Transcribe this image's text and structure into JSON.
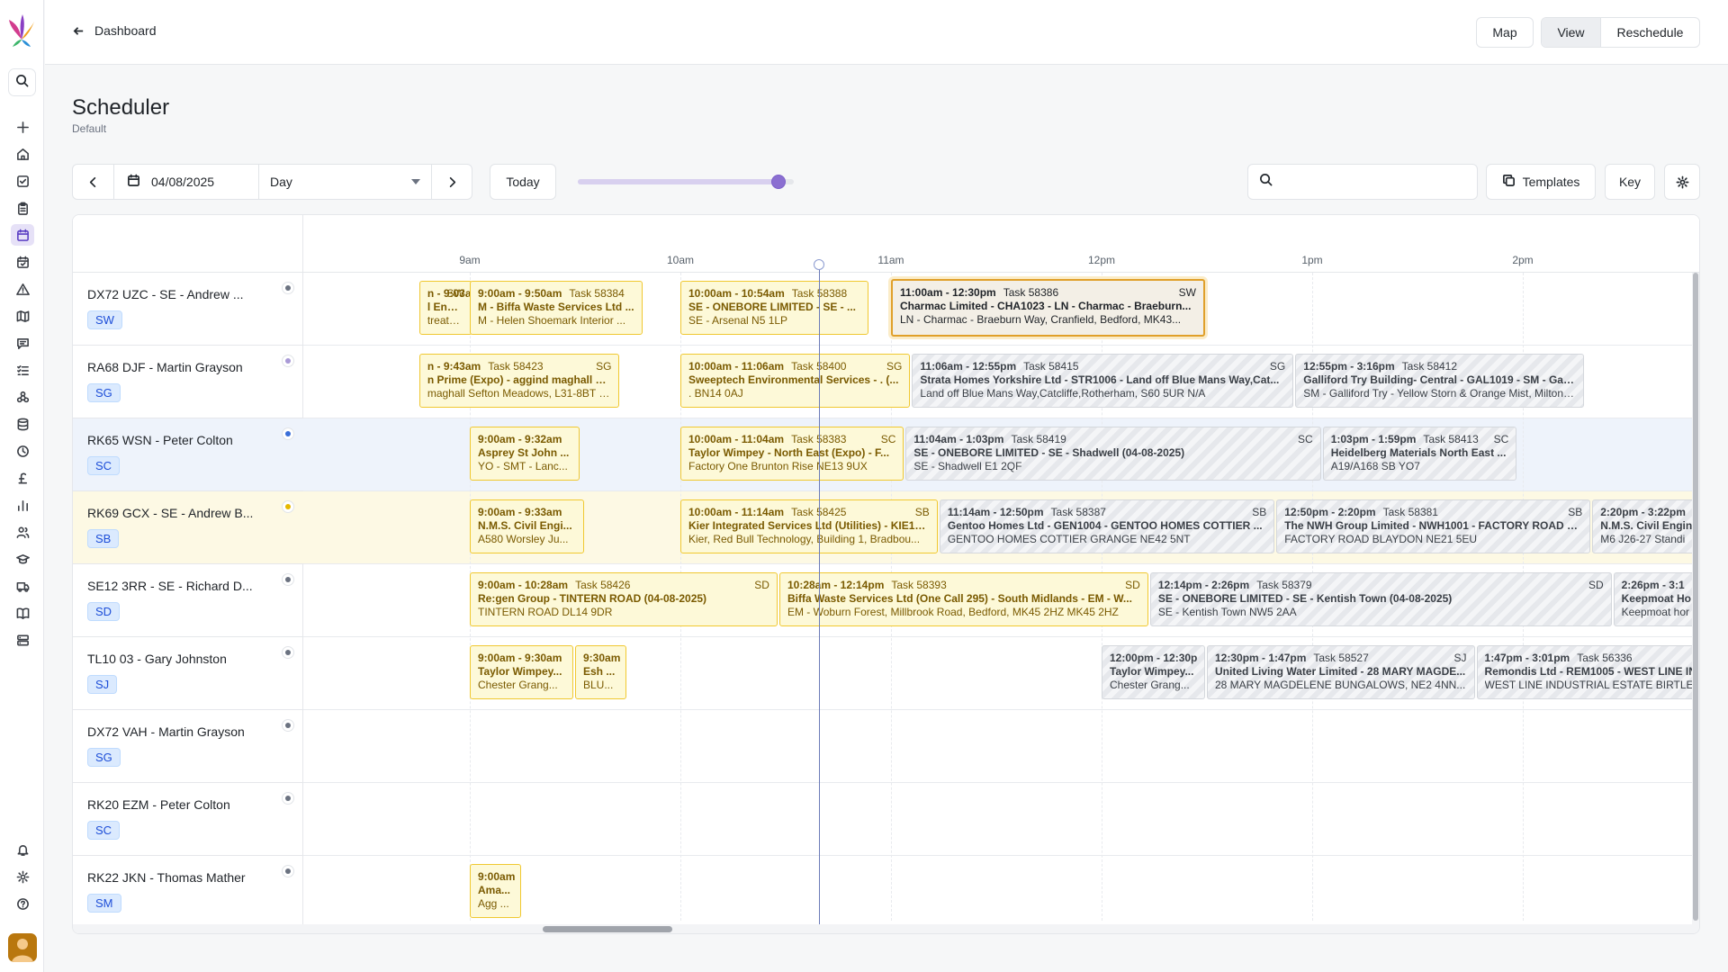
{
  "nav": {
    "back_label": "Dashboard"
  },
  "header_buttons": {
    "map": "Map",
    "view": "View",
    "reschedule": "Reschedule"
  },
  "page": {
    "title": "Scheduler",
    "subtitle": "Default"
  },
  "toolbar": {
    "date": "04/08/2025",
    "view_mode": "Day",
    "today_label": "Today",
    "zoom_level": 0.93,
    "search_placeholder": "",
    "templates_label": "Templates",
    "key_label": "Key"
  },
  "timeline": {
    "hours": [
      "9am",
      "10am",
      "11am",
      "12pm",
      "1pm",
      "2pm"
    ]
  },
  "resources": [
    {
      "name": "DX72 UZC - SE - Andrew ...",
      "badge": "SW",
      "status_color": "#6b7280"
    },
    {
      "name": "RA68 DJF - Martin Grayson",
      "badge": "SG",
      "status_color": "#a99ad6"
    },
    {
      "name": "RK65 WSN - Peter Colton",
      "badge": "SC",
      "status_color": "#3b6fd8"
    },
    {
      "name": "RK69 GCX - SE - Andrew B...",
      "badge": "SB",
      "status_color": "#e6b800"
    },
    {
      "name": "SE12 3RR - SE - Richard D...",
      "badge": "SD",
      "status_color": "#6b7280"
    },
    {
      "name": "TL10 03 - Gary Johnston",
      "badge": "SJ",
      "status_color": "#6b7280"
    },
    {
      "name": "DX72 VAH - Martin Grayson",
      "badge": "SG",
      "status_color": "#6b7280"
    },
    {
      "name": "RK20 EZM - Peter Colton",
      "badge": "SC",
      "status_color": "#6b7280"
    },
    {
      "name": "RK22 JKN - Thomas Mather",
      "badge": "SM",
      "status_color": "#6b7280"
    }
  ],
  "tasks": [
    {
      "row": 0,
      "start": 8.76,
      "end": 9.02,
      "style": "y",
      "time": "n - 9:03am",
      "task": "Task 58385",
      "initials": "SW",
      "title": "l Engineering & Utilities Ltd - S...",
      "addr": "treatment works, Wheatley Hal..."
    },
    {
      "row": 0,
      "start": 9.0,
      "end": 9.83,
      "style": "y",
      "time": "9:00am - 9:50am",
      "task": "Task 58384",
      "initials": "",
      "title": "M - Biffa Waste Services Ltd ...",
      "addr": "M - Helen Shoemark Interior ..."
    },
    {
      "row": 0,
      "start": 10.0,
      "end": 10.9,
      "style": "y",
      "time": "10:00am - 10:54am",
      "task": "Task 58388",
      "initials": "",
      "title": "SE - ONEBORE LIMITED - SE - ...",
      "addr": "SE - Arsenal N5 1LP"
    },
    {
      "row": 0,
      "start": 11.0,
      "end": 12.5,
      "style": "sel",
      "time": "11:00am - 12:30pm",
      "task": "Task 58386",
      "initials": "SW",
      "title": "Charmac Limited - CHA1023 - LN - Charmac - Braeburn...",
      "addr": "LN - Charmac - Braeburn Way, Cranfield, Bedford, MK43..."
    },
    {
      "row": 1,
      "start": 8.76,
      "end": 9.72,
      "style": "y",
      "time": "n - 9:43am",
      "task": "Task 58423",
      "initials": "SG",
      "title": "n Prime (Expo) - aggind maghall Sefton Meadows, L31-8B...",
      "addr": "maghall Sefton Meadows, L31-8BT L31-8BT"
    },
    {
      "row": 1,
      "start": 10.0,
      "end": 11.1,
      "style": "y",
      "time": "10:00am - 11:06am",
      "task": "Task 58400",
      "initials": "SG",
      "title": "Sweeptech Environmental Services - . (...",
      "addr": ". BN14 0AJ"
    },
    {
      "row": 1,
      "start": 11.1,
      "end": 12.92,
      "style": "g",
      "time": "11:06am - 12:55pm",
      "task": "Task 58415",
      "initials": "SG",
      "title": "Strata Homes Yorkshire Ltd - STR1006 - Land off Blue Mans Way,Cat...",
      "addr": "Land off Blue Mans Way,Catcliffe,Rotherham, S60 5UR N/A"
    },
    {
      "row": 1,
      "start": 12.92,
      "end": 14.3,
      "style": "g",
      "time": "12:55pm - 3:16pm",
      "task": "Task 58412",
      "initials": "",
      "title": "Galliford Try Building- Central - GAL1019 - SM - Galliford Try - Yellow Storn &",
      "addr": "SM - Galliford Try - Yellow Storn & Orange Mist, Milton Keynes, MK19 7BH MK"
    },
    {
      "row": 2,
      "start": 9.0,
      "end": 9.53,
      "style": "y",
      "time": "9:00am - 9:32am",
      "task": "",
      "initials": "",
      "title": "Asprey St John ...",
      "addr": "YO - SMT - Lanc..."
    },
    {
      "row": 2,
      "start": 10.0,
      "end": 11.07,
      "style": "y",
      "time": "10:00am - 11:04am",
      "task": "Task 58383",
      "initials": "SC",
      "title": "Taylor Wimpey - North East (Expo) - F...",
      "addr": "Factory One Brunton Rise NE13 9UX"
    },
    {
      "row": 2,
      "start": 11.07,
      "end": 13.05,
      "style": "g",
      "time": "11:04am - 1:03pm",
      "task": "Task 58419",
      "initials": "SC",
      "title": "SE - ONEBORE LIMITED - SE - Shadwell (04-08-2025)",
      "addr": "SE - Shadwell E1 2QF"
    },
    {
      "row": 2,
      "start": 13.05,
      "end": 13.98,
      "style": "g",
      "time": "1:03pm - 1:59pm",
      "task": "Task 58413",
      "initials": "SC",
      "title": "Heidelberg Materials North East ...",
      "addr": "A19/A168 SB YO7"
    },
    {
      "row": 3,
      "start": 9.0,
      "end": 9.55,
      "style": "y",
      "time": "9:00am - 9:33am",
      "task": "",
      "initials": "",
      "title": "N.M.S. Civil Engi...",
      "addr": "A580 Worsley Ju..."
    },
    {
      "row": 3,
      "start": 10.0,
      "end": 11.23,
      "style": "y",
      "time": "10:00am - 11:14am",
      "task": "Task 58425",
      "initials": "SB",
      "title": "Kier Integrated Services Ltd (Utilities) - KIE10...",
      "addr": "Kier, Red Bull Technology, Building 1, Bradbou..."
    },
    {
      "row": 3,
      "start": 11.23,
      "end": 12.83,
      "style": "g",
      "time": "11:14am - 12:50pm",
      "task": "Task 58387",
      "initials": "SB",
      "title": "Gentoo Homes Ltd - GEN1004 - GENTOO HOMES COTTIER ...",
      "addr": "GENTOO HOMES COTTIER GRANGE NE42 5NT"
    },
    {
      "row": 3,
      "start": 12.83,
      "end": 14.33,
      "style": "g",
      "time": "12:50pm - 2:20pm",
      "task": "Task 58381",
      "initials": "SB",
      "title": "The NWH Group Limited - NWH1001 - FACTORY ROAD B...",
      "addr": "FACTORY ROAD BLAYDON NE21 5EU"
    },
    {
      "row": 3,
      "start": 14.33,
      "end": 14.9,
      "style": "g",
      "time": "2:20pm - 3:22pm",
      "task": "",
      "initials": "",
      "title": "N.M.S. Civil Engin",
      "addr": "M6 J26-27 Standi"
    },
    {
      "row": 4,
      "start": 9.0,
      "end": 10.47,
      "style": "y",
      "time": "9:00am - 10:28am",
      "task": "Task 58426",
      "initials": "SD",
      "title": "Re:gen Group - TINTERN ROAD (04-08-2025)",
      "addr": "TINTERN ROAD DL14 9DR"
    },
    {
      "row": 4,
      "start": 10.47,
      "end": 12.23,
      "style": "y",
      "time": "10:28am - 12:14pm",
      "task": "Task 58393",
      "initials": "SD",
      "title": "Biffa Waste Services Ltd (One Call 295) - South Midlands - EM - W...",
      "addr": "EM - Woburn Forest, Millbrook Road, Bedford, MK45 2HZ MK45 2HZ"
    },
    {
      "row": 4,
      "start": 12.23,
      "end": 14.43,
      "style": "g",
      "time": "12:14pm - 2:26pm",
      "task": "Task 58379",
      "initials": "SD",
      "title": "SE - ONEBORE LIMITED - SE - Kentish Town (04-08-2025)",
      "addr": "SE - Kentish Town NW5 2AA"
    },
    {
      "row": 4,
      "start": 14.43,
      "end": 14.9,
      "style": "g",
      "time": "2:26pm - 3:1",
      "task": "",
      "initials": "",
      "title": "Keepmoat Ho",
      "addr": "Keepmoat hor"
    },
    {
      "row": 5,
      "start": 9.0,
      "end": 9.5,
      "style": "y",
      "time": "9:00am - 9:30am",
      "task": "",
      "initials": "",
      "title": "Taylor Wimpey...",
      "addr": "Chester Grang..."
    },
    {
      "row": 5,
      "start": 9.5,
      "end": 9.75,
      "style": "y",
      "time": "9:30am",
      "task": "",
      "initials": "",
      "title": "Esh ...",
      "addr": "BLU..."
    },
    {
      "row": 5,
      "start": 12.0,
      "end": 12.5,
      "style": "g",
      "time": "12:00pm - 12:30p",
      "task": "",
      "initials": "",
      "title": "Taylor Wimpey...",
      "addr": "Chester Grang..."
    },
    {
      "row": 5,
      "start": 12.5,
      "end": 13.78,
      "style": "g",
      "time": "12:30pm - 1:47pm",
      "task": "Task 58527",
      "initials": "SJ",
      "title": "United Living Water Limited - 28 MARY MAGDE...",
      "addr": "28 MARY MAGDELENE BUNGALOWS, NE2 4NN..."
    },
    {
      "row": 5,
      "start": 13.78,
      "end": 14.9,
      "style": "g",
      "time": "1:47pm - 3:01pm",
      "task": "Task 56336",
      "initials": "",
      "title": "Remondis Ltd - REM1005 - WEST LINE IN",
      "addr": "WEST LINE INDUSTRIAL ESTATE BIRTLE"
    },
    {
      "row": 8,
      "start": 9.0,
      "end": 9.25,
      "style": "y",
      "time": "9:00am",
      "task": "",
      "initials": "",
      "title": "Ama...",
      "addr": "Agg ..."
    }
  ],
  "now_time": 10.66
}
